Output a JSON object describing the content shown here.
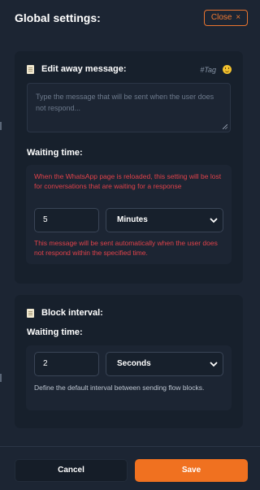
{
  "header": {
    "title": "Global settings:",
    "close_label": "Close",
    "close_icon": "×"
  },
  "away_message": {
    "label": "Edit away message:",
    "tag_label": "#Tag",
    "emoji_icon": "smile-emoji-icon",
    "placeholder": "Type the message that will be sent when the user does not respond...",
    "value": "",
    "waiting_label": "Waiting time:",
    "warning": "When the WhatsApp page is reloaded, this setting will be lost for conversations that are waiting for a response",
    "time_value": "5",
    "unit_selected": "Minutes",
    "description": "This message will be sent automatically when the user does not respond within the specified time."
  },
  "block_interval": {
    "label": "Block interval:",
    "waiting_label": "Waiting time:",
    "time_value": "2",
    "unit_selected": "Seconds",
    "description": "Define the default interval between sending flow blocks."
  },
  "footer": {
    "cancel_label": "Cancel",
    "save_label": "Save"
  },
  "colors": {
    "background": "#1c2533",
    "card": "#17202c",
    "accent": "#f07120",
    "warning": "#e0424a"
  }
}
